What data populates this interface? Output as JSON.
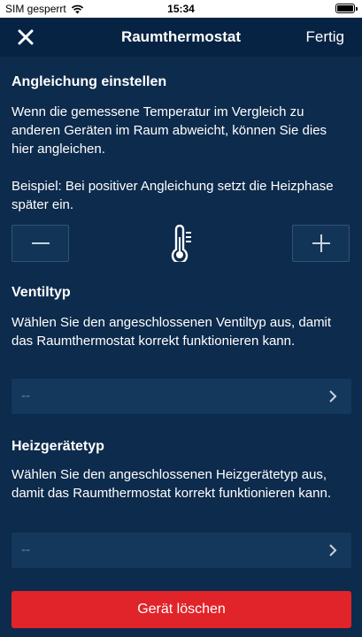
{
  "status_bar": {
    "carrier": "SIM gesperrt",
    "time": "15:34",
    "battery_level": 1.0
  },
  "nav": {
    "close_icon": "close-icon",
    "title": "Raumthermostat",
    "done_label": "Fertig"
  },
  "calibration": {
    "title": "Angleichung einstellen",
    "description": "Wenn die gemessene Temperatur im Vergleich zu anderen Geräten im Raum abweicht, können Sie dies hier angleichen.",
    "example": "Beispiel: Bei positiver Angleichung setzt die Heizphase später ein.",
    "minus_icon": "minus-icon",
    "thermometer_icon": "thermometer-icon",
    "plus_icon": "plus-icon"
  },
  "valve_type": {
    "title": "Ventiltyp",
    "description": "Wählen Sie den angeschlossenen Ventiltyp aus, damit das Raumthermostat korrekt funktionieren kann.",
    "value": "--"
  },
  "heater_type": {
    "title": "Heizgerätetyp",
    "description": "Wählen Sie den angeschlossenen Heizgerätetyp aus, damit das Raumthermostat korrekt funktionieren kann.",
    "value": "--"
  },
  "delete_label": "Gerät löschen",
  "colors": {
    "background": "#0d2b4c",
    "navbar": "#072343",
    "field": "#14385c",
    "danger": "#e1242a"
  }
}
